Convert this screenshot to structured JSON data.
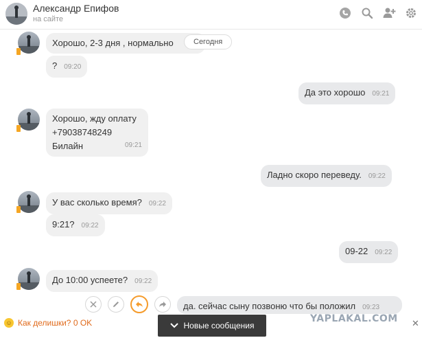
{
  "header": {
    "name": "Александр Епифов",
    "status": "на сайте",
    "icons": [
      "phone-icon",
      "search-icon",
      "add-user-icon",
      "settings-icon"
    ]
  },
  "today_label": "Сегодня",
  "messages": [
    {
      "dir": "in",
      "text": "Хорошо, 2-3 дня , нормально",
      "time": ""
    },
    {
      "dir": "in",
      "text": "?",
      "time": "09:20"
    },
    {
      "dir": "out",
      "text": "Да это хорошо",
      "time": "09:21"
    },
    {
      "dir": "in",
      "lines": [
        "Хорошо, жду оплату",
        "+79038748249",
        "Билайн"
      ],
      "time": "09:21"
    },
    {
      "dir": "out",
      "text": "Ладно скоро переведу.",
      "time": "09:22"
    },
    {
      "dir": "in",
      "text": "У вас сколько время?",
      "time": "09:22"
    },
    {
      "dir": "in",
      "text": "9:21?",
      "time": "09:22"
    },
    {
      "dir": "out",
      "text": "09-22",
      "time": "09:22"
    },
    {
      "dir": "in",
      "text": "До 10:00 успеете?",
      "time": "09:22"
    },
    {
      "dir": "out",
      "text": "да. сейчас сыну позвоню что бы положил",
      "time": "09:23"
    }
  ],
  "message_actions": [
    "close-icon",
    "edit-icon",
    "reply-icon",
    "forward-icon"
  ],
  "footer": {
    "mood_text": "Как делишки? 0 OK",
    "new_messages_label": "Новые сообщения",
    "watermark": "YAPLAKAL.COM",
    "close_glyph": "✕"
  },
  "colors": {
    "accent_orange": "#f59b2b",
    "mood_orange": "#e06a1b",
    "bubble_in": "#f0f0f0",
    "bubble_out": "#e8e9eb"
  }
}
